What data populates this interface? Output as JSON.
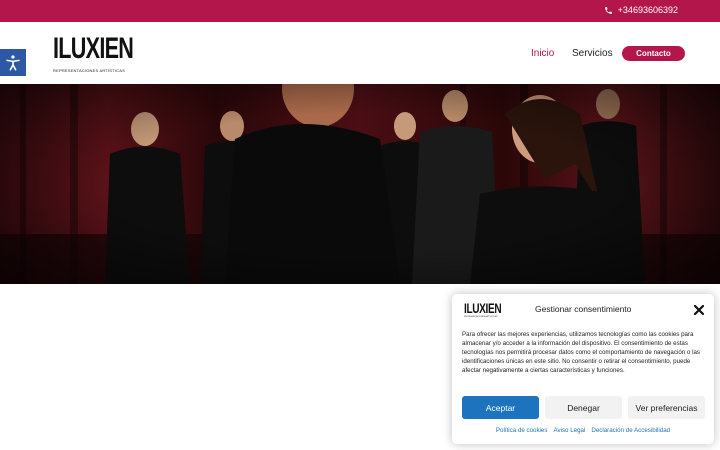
{
  "topbar": {
    "phone": "+34693606392"
  },
  "header": {
    "logo_main": "ILUXIEN",
    "logo_sub": "REPRESENTACIONES ARTÍSTICAS",
    "nav": {
      "inicio": "Inicio",
      "servicios": "Servicios",
      "contacto": "Contacto"
    }
  },
  "hero": {
    "image": "actors-rehearsal-stage-photo"
  },
  "consent": {
    "logo_main": "ILUXIEN",
    "logo_sub": "REPRESENTACIONES ARTÍSTICAS",
    "title": "Gestionar consentimiento",
    "body": "Para ofrecer las mejores experiencias, utilizamos tecnologías como las cookies para almacenar y/o acceder a la información del dispositivo. El consentimiento de estas tecnologías nos permitirá procesar datos como el comportamiento de navegación o las identificaciones únicas en este sitio. No consentir o retirar el consentimiento, puede afectar negativamente a ciertas características y funciones.",
    "accept": "Aceptar",
    "deny": "Denegar",
    "prefs": "Ver preferencias",
    "links": [
      "Política de cookies",
      "Aviso Legal",
      "Declaración de Accesibilidad"
    ]
  },
  "colors": {
    "brand": "#b3164a",
    "accessibility": "#2e57a6",
    "accept": "#1e73be"
  }
}
